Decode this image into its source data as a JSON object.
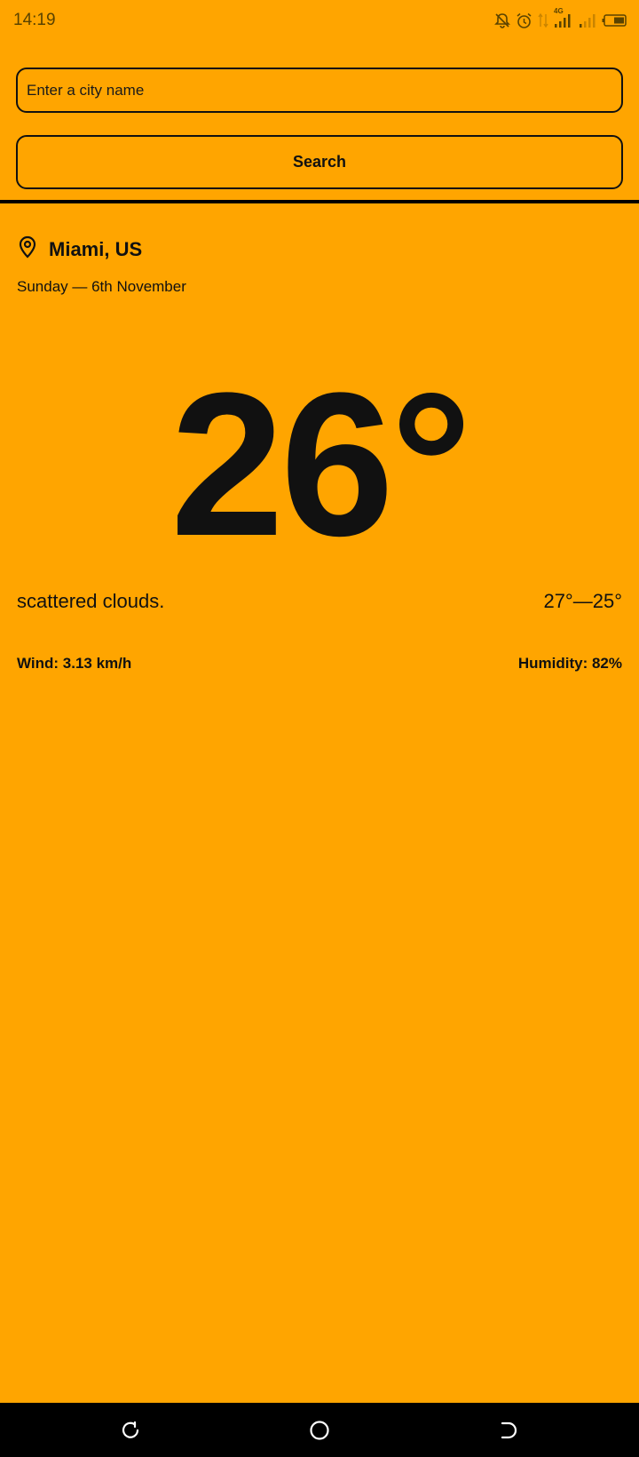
{
  "status_bar": {
    "time": "14:19",
    "network_label": "4G",
    "icons": [
      "bell-off-icon",
      "alarm-icon",
      "data-arrows-icon",
      "signal-icon",
      "signal-icon",
      "battery-icon"
    ]
  },
  "search": {
    "placeholder": "Enter a city name",
    "value": "",
    "button_label": "Search"
  },
  "weather": {
    "location": "Miami, US",
    "location_icon": "map-pin-icon",
    "date": "Sunday — 6th November",
    "temperature": "26°",
    "description": "scattered clouds.",
    "range": "27°—25°",
    "wind": "Wind: 3.13 km/h",
    "humidity": "Humidity: 82%"
  },
  "nav_bar": {
    "icons": [
      "recent-apps-icon",
      "home-icon",
      "back-icon"
    ]
  },
  "colors": {
    "background": "#FFA500",
    "text": "#111111",
    "nav_background": "#000000"
  }
}
